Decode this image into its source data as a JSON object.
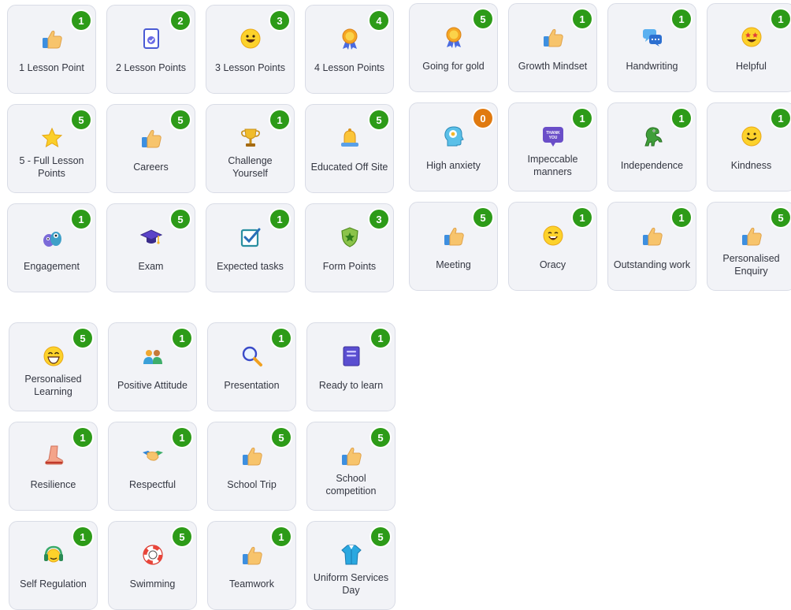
{
  "colors": {
    "card_background": "#f2f3f7",
    "card_border": "#d9dce6",
    "badge_positive": "#2d9b18",
    "badge_zero": "#e07a10",
    "label_text": "#333641"
  },
  "groups": [
    {
      "id": "grid-a",
      "cards": [
        {
          "label": "1 Lesson Point",
          "points": "1",
          "icon": "thumbs-up-icon"
        },
        {
          "label": "2 Lesson Points",
          "points": "2",
          "icon": "document-check-icon"
        },
        {
          "label": "3 Lesson Points",
          "points": "3",
          "icon": "smiley-face-icon"
        },
        {
          "label": "4 Lesson Points",
          "points": "4",
          "icon": "award-rosette-icon"
        },
        {
          "label": "5 - Full Lesson Points",
          "points": "5",
          "icon": "star-icon"
        },
        {
          "label": "Careers",
          "points": "5",
          "icon": "thumbs-up-icon"
        },
        {
          "label": "Challenge Yourself",
          "points": "1",
          "icon": "trophy-icon"
        },
        {
          "label": "Educated Off Site",
          "points": "5",
          "icon": "bell-icon"
        },
        {
          "label": "Engagement",
          "points": "1",
          "icon": "monsters-icon"
        },
        {
          "label": "Exam",
          "points": "5",
          "icon": "graduation-cap-icon"
        },
        {
          "label": "Expected tasks",
          "points": "1",
          "icon": "checkbox-icon"
        },
        {
          "label": "Form Points",
          "points": "3",
          "icon": "shield-star-icon"
        }
      ]
    },
    {
      "id": "grid-b",
      "cards": [
        {
          "label": "Going for gold",
          "points": "5",
          "icon": "award-rosette-icon"
        },
        {
          "label": "Growth Mindset",
          "points": "1",
          "icon": "thumbs-up-icon"
        },
        {
          "label": "Handwriting",
          "points": "1",
          "icon": "chat-bubbles-icon"
        },
        {
          "label": "Helpful",
          "points": "1",
          "icon": "star-eyes-face-icon"
        },
        {
          "label": "High anxiety",
          "points": "0",
          "icon": "head-thought-icon"
        },
        {
          "label": "Impeccable manners",
          "points": "1",
          "icon": "thank-you-bubble-icon",
          "icon_text": "THANK YOU"
        },
        {
          "label": "Independence",
          "points": "1",
          "icon": "dinosaur-icon"
        },
        {
          "label": "Kindness",
          "points": "1",
          "icon": "smile-face-icon"
        },
        {
          "label": "Meeting",
          "points": "5",
          "icon": "thumbs-up-icon"
        },
        {
          "label": "Oracy",
          "points": "1",
          "icon": "speech-face-icon"
        },
        {
          "label": "Outstanding work",
          "points": "1",
          "icon": "thumbs-up-icon"
        },
        {
          "label": "Personalised Enquiry",
          "points": "5",
          "icon": "thumbs-up-icon"
        }
      ]
    },
    {
      "id": "grid-c",
      "cards": [
        {
          "label": "Personalised Learning",
          "points": "5",
          "icon": "grin-face-icon"
        },
        {
          "label": "Positive Attitude",
          "points": "1",
          "icon": "people-icon"
        },
        {
          "label": "Presentation",
          "points": "1",
          "icon": "magnifier-icon"
        },
        {
          "label": "Ready to learn",
          "points": "1",
          "icon": "book-icon"
        },
        {
          "label": "Resilience",
          "points": "1",
          "icon": "boot-icon"
        },
        {
          "label": "Respectful",
          "points": "1",
          "icon": "handshake-icon"
        },
        {
          "label": "School Trip",
          "points": "5",
          "icon": "thumbs-up-icon"
        },
        {
          "label": "School competition",
          "points": "5",
          "icon": "thumbs-up-icon"
        },
        {
          "label": "Self Regulation",
          "points": "1",
          "icon": "headphones-icon"
        },
        {
          "label": "Swimming",
          "points": "5",
          "icon": "lifebuoy-icon"
        },
        {
          "label": "Teamwork",
          "points": "1",
          "icon": "thumbs-up-icon"
        },
        {
          "label": "Uniform Services Day",
          "points": "5",
          "icon": "shirt-icon"
        }
      ]
    }
  ]
}
